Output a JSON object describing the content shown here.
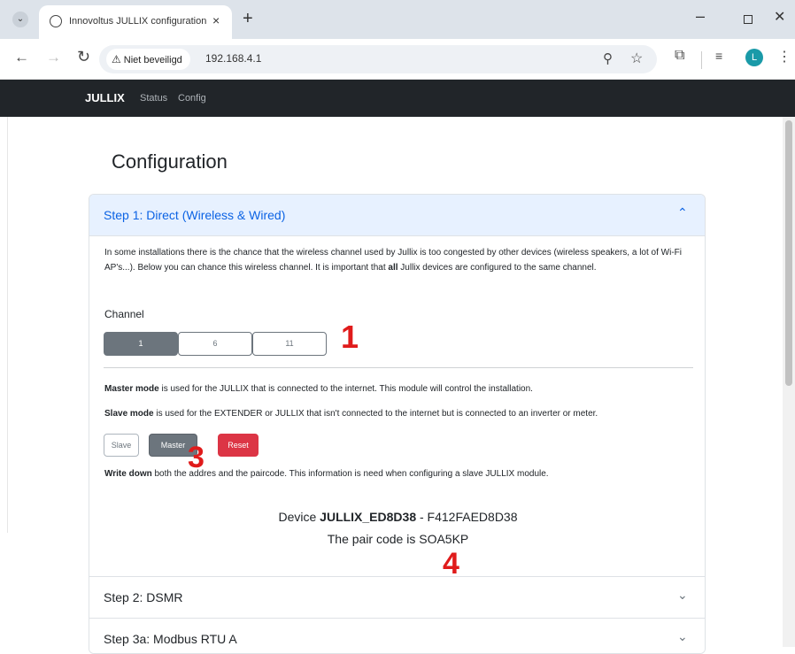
{
  "browser": {
    "tab_title": "Innovoltus JULLIX configuration",
    "tab_close": "×",
    "new_tab": "+",
    "security_label": "Niet beveiligd",
    "url": "192.168.4.1",
    "profile_initial": "L",
    "window_controls": {
      "minimize": "–",
      "close": "✕"
    },
    "icons": [
      "tab-search-icon",
      "globe-icon",
      "back-icon",
      "forward-icon",
      "reload-icon",
      "warning-icon",
      "zoom-icon",
      "star-icon",
      "extensions-icon",
      "media-icon",
      "menu-icon"
    ]
  },
  "navbar": {
    "brand": "JULLIX",
    "links": [
      "Status",
      "Config"
    ],
    "background": "#212529"
  },
  "page": {
    "title": "Configuration"
  },
  "accordion": {
    "step1": {
      "title": "Step 1: Direct (Wireless & Wired)",
      "expanded": true,
      "intro_before_bold": "In some installations there is the chance that the wireless channel used by Jullix is too congested by other devices (wireless speakers, a lot of Wi-Fi AP's...). Below you can chance this wireless channel. It is important that ",
      "intro_bold": "all",
      "intro_after_bold": " Jullix devices are configured to the same channel.",
      "channel_label": "Channel",
      "channels": [
        "1",
        "6",
        "11"
      ],
      "selected_channel": "1",
      "master_bold": "Master mode",
      "master_text": " is used for the JULLIX that is connected to the internet. This module will control the installation.",
      "slave_bold": "Slave mode",
      "slave_text": " is used for the EXTENDER or JULLIX that isn't connected to the internet but is connected to an inverter or meter.",
      "buttons": {
        "slave": "Slave",
        "master": "Master",
        "reset": "Reset"
      },
      "selected_mode": "Master",
      "write_bold": "Write down",
      "write_text": " both the addres and the paircode. This information is need when configuring a slave JULLIX module.",
      "device_prefix": "Device ",
      "device_name": "JULLIX_ED8D38",
      "device_suffix": " - F412FAED8D38",
      "pair_code_line": "The pair code is SOA5KP"
    },
    "step2": {
      "title": "Step 2: DSMR",
      "expanded": false
    },
    "step3a": {
      "title": "Step 3a: Modbus RTU A",
      "expanded": false
    }
  },
  "annotations": [
    "1",
    "3",
    "4"
  ],
  "colors": {
    "accent": "#0c63e4",
    "accordion_active_bg": "#e7f1ff",
    "secondary": "#6c757d",
    "danger": "#dc3545",
    "annotation": "#e01b1b"
  }
}
